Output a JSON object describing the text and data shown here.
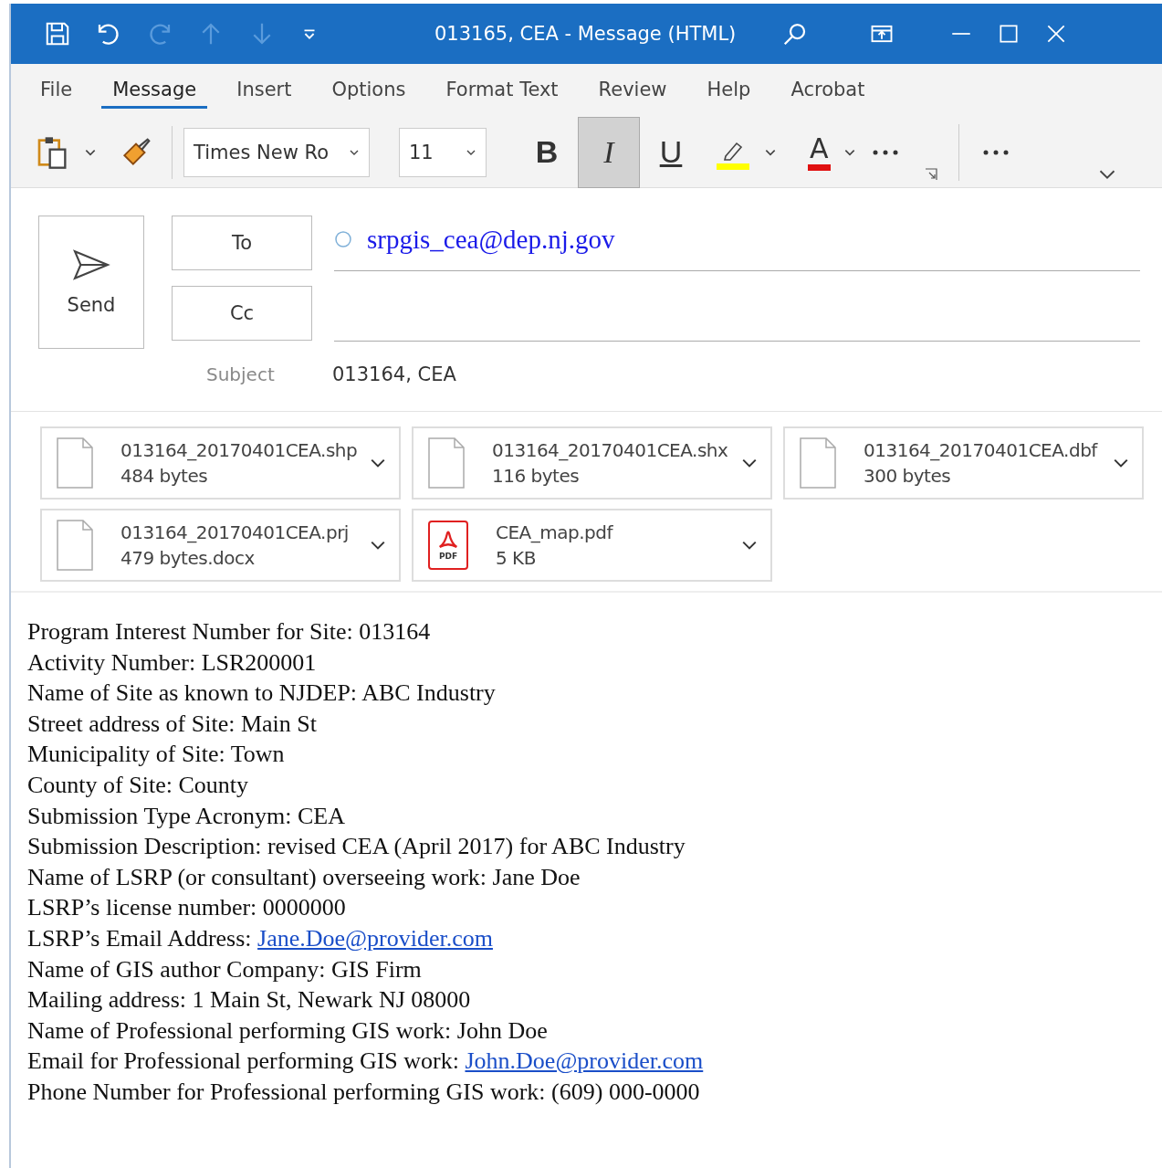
{
  "window": {
    "title": "013165, CEA  -  Message (HTML)"
  },
  "tabs": [
    {
      "label": "File",
      "selected": false
    },
    {
      "label": "Message",
      "selected": true
    },
    {
      "label": "Insert",
      "selected": false
    },
    {
      "label": "Options",
      "selected": false
    },
    {
      "label": "Format Text",
      "selected": false
    },
    {
      "label": "Review",
      "selected": false
    },
    {
      "label": "Help",
      "selected": false
    },
    {
      "label": "Acrobat",
      "selected": false
    }
  ],
  "toolbar": {
    "font": "Times New Ro",
    "size": "11",
    "format_buttons": [
      {
        "label": "B",
        "kind": "bold",
        "selected": false
      },
      {
        "label": "I",
        "kind": "italic",
        "selected": true
      },
      {
        "label": "U",
        "kind": "underline",
        "selected": false
      }
    ],
    "font_color_label": "A"
  },
  "compose": {
    "send": "Send",
    "to_button": "To",
    "cc_button": "Cc",
    "to": "srpgis_cea@dep.nj.gov",
    "subject_label": "Subject",
    "subject": "013164, CEA"
  },
  "attachments": [
    {
      "name": "013164_20170401CEA.shp",
      "size": "484 bytes",
      "kind": "file"
    },
    {
      "name": "013164_20170401CEA.shx",
      "size": "116 bytes",
      "kind": "file"
    },
    {
      "name": "013164_20170401CEA.dbf",
      "size": "300 bytes",
      "kind": "file"
    },
    {
      "name": "013164_20170401CEA.prj",
      "size": "479 bytes.docx",
      "kind": "file"
    },
    {
      "name": "CEA_map.pdf",
      "size": "5 KB",
      "kind": "pdf",
      "icon_label": "PDF"
    }
  ],
  "body": [
    {
      "text": "Program Interest Number for Site: 013164"
    },
    {
      "text": "Activity Number: LSR200001"
    },
    {
      "text": "Name of Site as known to NJDEP: ABC Industry"
    },
    {
      "text": "Street address of Site: Main St"
    },
    {
      "text": "Municipality of Site: Town"
    },
    {
      "text": "County of Site: County"
    },
    {
      "text": "Submission Type Acronym: CEA"
    },
    {
      "text": "Submission Description: revised CEA (April 2017) for ABC Industry"
    },
    {
      "text": "Name of LSRP (or consultant) overseeing work: Jane Doe"
    },
    {
      "text": "LSRP’s license number: 0000000"
    },
    {
      "text": "LSRP’s Email Address: ",
      "link": "Jane.Doe@provider.com"
    },
    {
      "text": "Name of GIS author Company: GIS Firm"
    },
    {
      "text": "Mailing address: 1 Main St, Newark NJ 08000"
    },
    {
      "text": "Name of Professional performing GIS work: John Doe"
    },
    {
      "text": "Email for Professional performing GIS work: ",
      "link": "John.Doe@provider.com"
    },
    {
      "text": "Phone Number for Professional performing GIS work: (609) 000-0000"
    }
  ]
}
